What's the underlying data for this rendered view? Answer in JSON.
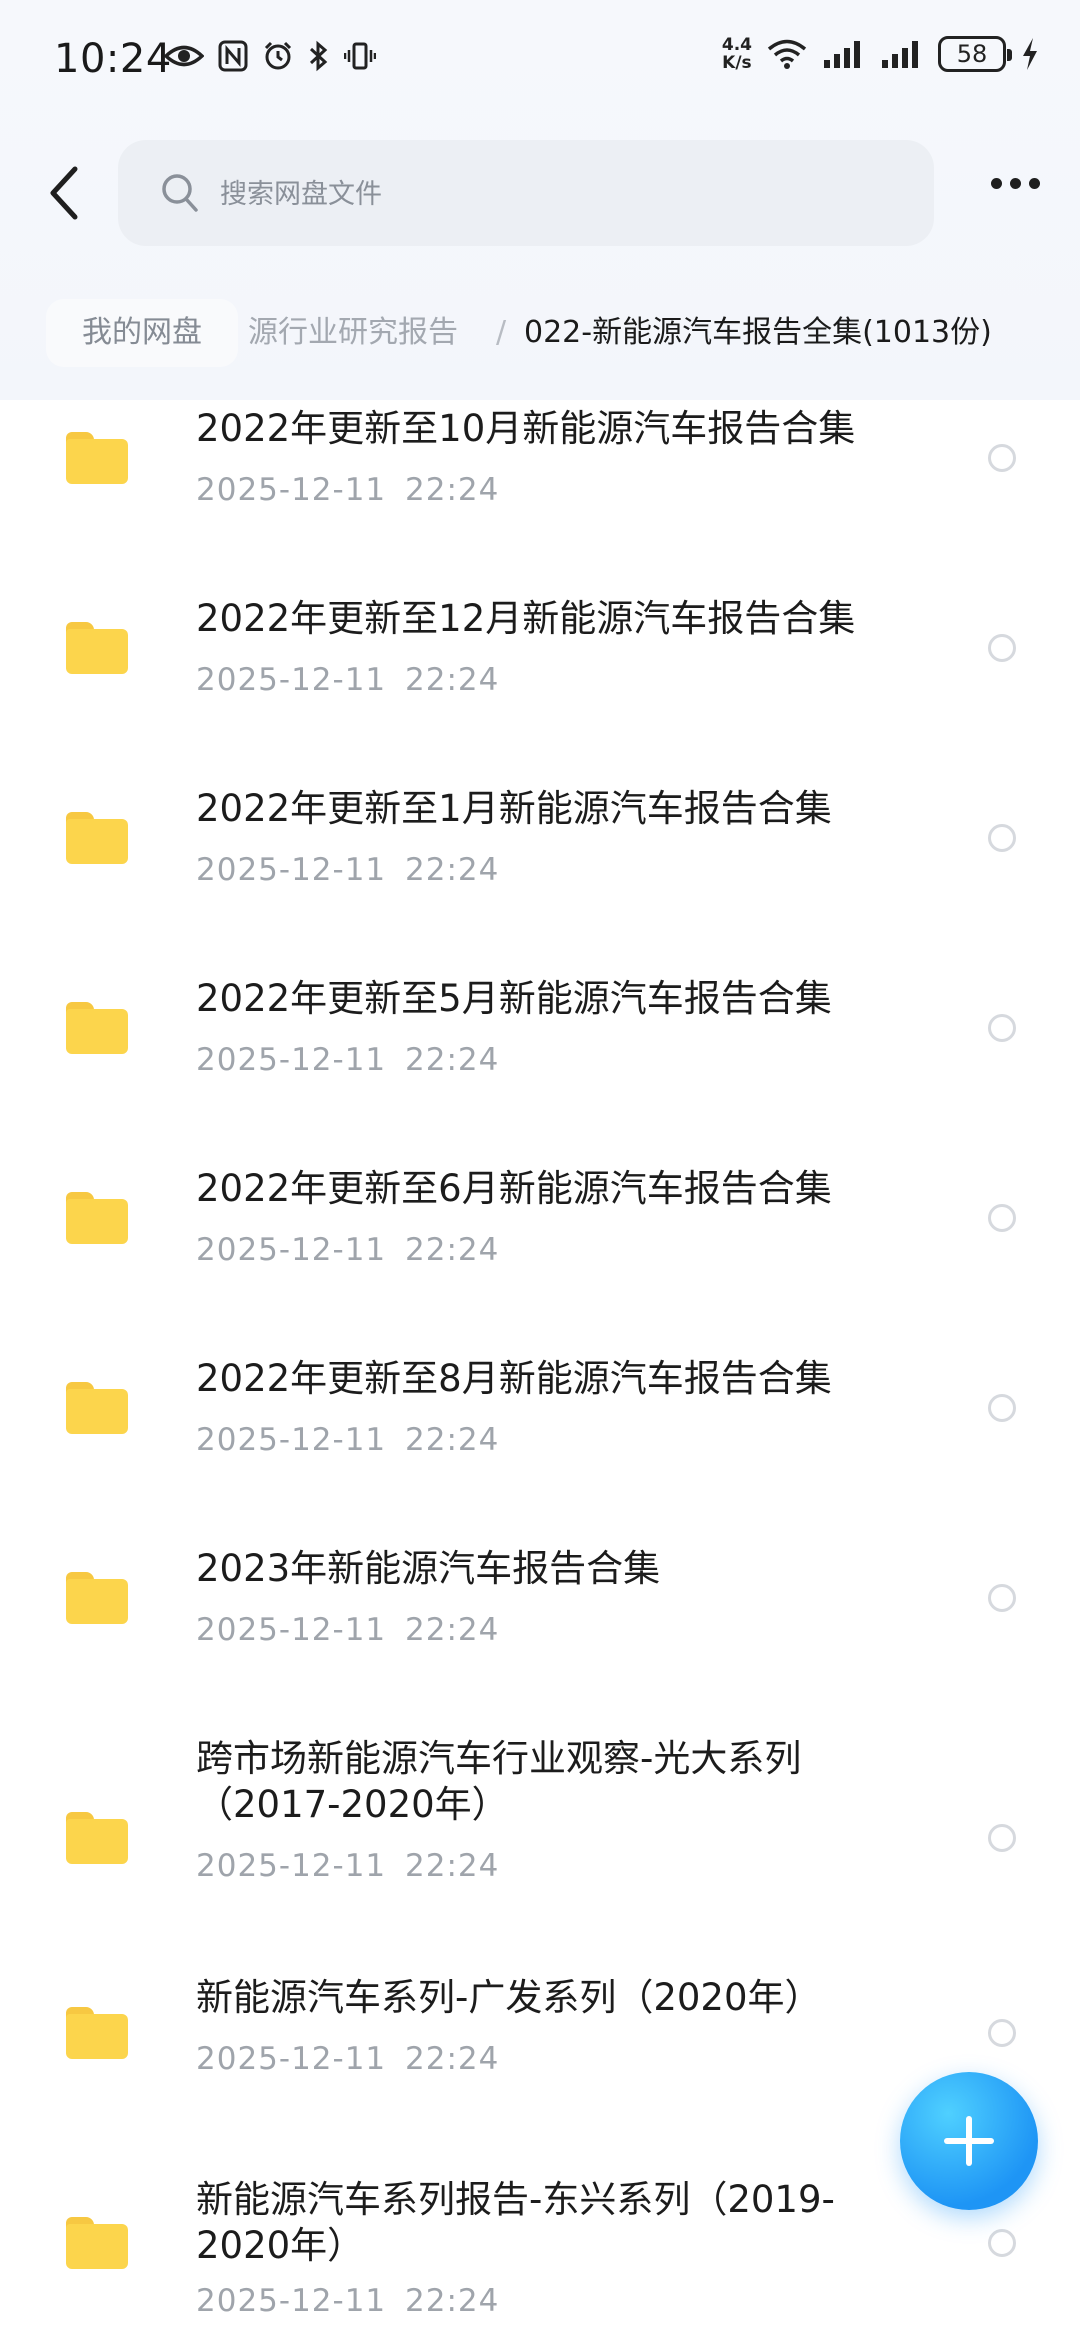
{
  "status_bar": {
    "time": "10:24",
    "net_speed_value": "4.4",
    "net_speed_unit": "K/s",
    "battery": "58",
    "icons": [
      "eye-icon",
      "nfc-icon",
      "alarm-icon",
      "bluetooth-icon",
      "vibrate-icon",
      "wifi-icon",
      "signal-icon",
      "charging-icon"
    ]
  },
  "header": {
    "search_placeholder": "搜索网盘文件"
  },
  "breadcrumb": {
    "root": "我的网盘",
    "middle": "源行业研究报告",
    "separator": "/",
    "current": "022-新能源汽车报告全集(1013份)"
  },
  "files": [
    {
      "name": "2022年更新至10月新能源汽车报告合集",
      "date": "2025-12-11  22:24"
    },
    {
      "name": "2022年更新至12月新能源汽车报告合集",
      "date": "2025-12-11  22:24"
    },
    {
      "name": "2022年更新至1月新能源汽车报告合集",
      "date": "2025-12-11  22:24"
    },
    {
      "name": "2022年更新至5月新能源汽车报告合集",
      "date": "2025-12-11  22:24"
    },
    {
      "name": "2022年更新至6月新能源汽车报告合集",
      "date": "2025-12-11  22:24"
    },
    {
      "name": "2022年更新至8月新能源汽车报告合集",
      "date": "2025-12-11  22:24"
    },
    {
      "name": "2023年新能源汽车报告合集",
      "date": "2025-12-11  22:24"
    },
    {
      "name": "跨市场新能源汽车行业观察-光大系列（2017-2020年）",
      "date": "2025-12-11  22:24"
    },
    {
      "name": "新能源汽车系列-广发系列（2020年）",
      "date": "2025-12-11  22:24"
    },
    {
      "name": "新能源汽车系列报告-东兴系列（2019-2020年）",
      "date": "2025-12-11  22:24"
    }
  ],
  "colors": {
    "folder": "#fcd54c",
    "fab": "#1e95f5",
    "text_primary": "#1c1c1c",
    "text_secondary": "#9fa4ab"
  }
}
